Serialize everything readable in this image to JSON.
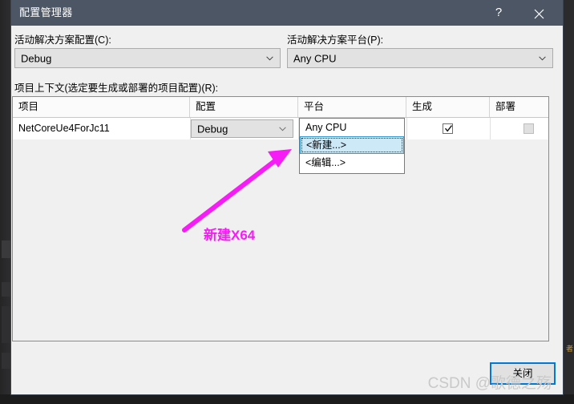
{
  "window": {
    "title": "配置管理器",
    "help_label": "?",
    "close_icon": "close-x-icon",
    "titlebar_color": "#4c5664"
  },
  "solution_config": {
    "label": "活动解决方案配置(C):",
    "value": "Debug",
    "chevron_icon": "chevron-down-icon"
  },
  "solution_platform": {
    "label": "活动解决方案平台(P):",
    "value": "Any CPU",
    "chevron_icon": "chevron-down-icon"
  },
  "project_context": {
    "label": "项目上下文(选定要生成或部署的项目配置)(R):",
    "columns": [
      "项目",
      "配置",
      "平台",
      "生成",
      "部署"
    ],
    "rows": [
      {
        "project": "NetCoreUe4ForJc11",
        "configuration": "Debug",
        "platform": "Any CPU",
        "build_checked": "✓",
        "deploy_checked": ""
      }
    ]
  },
  "platform_dropdown": {
    "open": "true",
    "items": [
      "Any CPU",
      "<新建...>",
      "<编辑...>"
    ],
    "selected": "<新建...>",
    "highlight_color": "#cde8f7"
  },
  "footer": {
    "close_label": "关闭",
    "focus_color": "#0078d7"
  },
  "annotation": {
    "text": "新建X64",
    "color": "#f51cf5",
    "arrow_icon": "arrow-pointer-icon"
  },
  "watermark": {
    "text": "CSDN @歌德之殇"
  },
  "backdrop": {
    "side_label": "者"
  }
}
